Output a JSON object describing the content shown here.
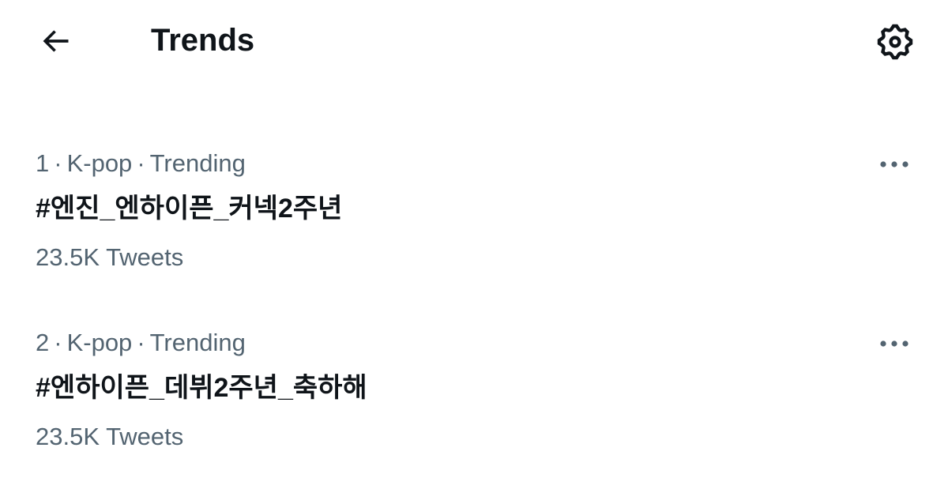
{
  "header": {
    "title": "Trends",
    "back_icon": "arrow-left-icon",
    "settings_icon": "gear-icon"
  },
  "trends": [
    {
      "rank": "1",
      "category": "K-pop",
      "status": "Trending",
      "name": "#엔진_엔하이픈_커넥2주년",
      "count": "23.5K Tweets",
      "more_icon": "more-horizontal-icon"
    },
    {
      "rank": "2",
      "category": "K-pop",
      "status": "Trending",
      "name": "#엔하이픈_데뷔2주년_축하해",
      "count": "23.5K Tweets",
      "more_icon": "more-horizontal-icon"
    }
  ],
  "colors": {
    "primary_text": "#0f1419",
    "secondary_text": "#536471",
    "background": "#ffffff"
  }
}
